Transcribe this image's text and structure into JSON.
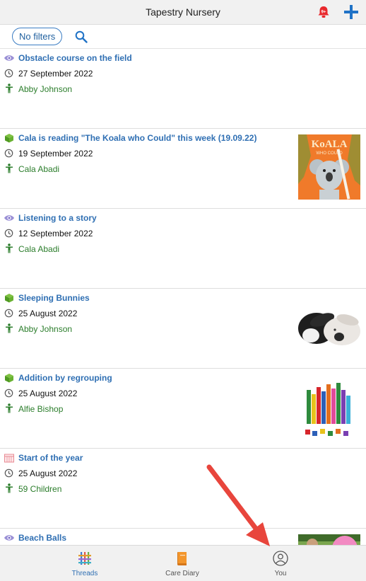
{
  "header": {
    "title": "Tapestry Nursery",
    "notifications_badge": "9+",
    "accent": "#1f72c6",
    "bell_color": "#e8282c"
  },
  "filters": {
    "label": "No filters"
  },
  "entries": [
    {
      "type": "observation",
      "title": "Obstacle course on the field",
      "date": "27 September 2022",
      "child": "Abby Johnson",
      "has_thumb": false
    },
    {
      "type": "activity",
      "title": "Cala is reading \"The Koala who Could\" this week (19.09.22)",
      "date": "19 September 2022",
      "child": "Cala Abadi",
      "has_thumb": true,
      "thumb": {
        "line1": "KoALA",
        "line2": "WHO COULD"
      }
    },
    {
      "type": "observation",
      "title": "Listening to a story",
      "date": "12 September 2022",
      "child": "Cala Abadi",
      "has_thumb": false
    },
    {
      "type": "activity",
      "title": "Sleeping Bunnies",
      "date": "25 August 2022",
      "child": "Abby Johnson",
      "has_thumb": true
    },
    {
      "type": "activity",
      "title": "Addition by regrouping",
      "date": "25 August 2022",
      "child": "Alfie Bishop",
      "has_thumb": true
    },
    {
      "type": "planning",
      "title": "Start of the year",
      "date": "25 August 2022",
      "child": "59 Children",
      "has_thumb": false
    },
    {
      "type": "observation",
      "title": "Beach Balls",
      "date": "",
      "child": "",
      "has_thumb": true
    }
  ],
  "bottom_nav": {
    "threads": "Threads",
    "care_diary": "Care Diary",
    "you": "You"
  },
  "colors": {
    "link_blue": "#2f6fb3",
    "child_green": "#2b7d2b",
    "annotation_red": "#e8453c"
  },
  "icons": {
    "observation": "eye-icon",
    "activity": "cube-icon",
    "planning": "calendar-icon"
  }
}
